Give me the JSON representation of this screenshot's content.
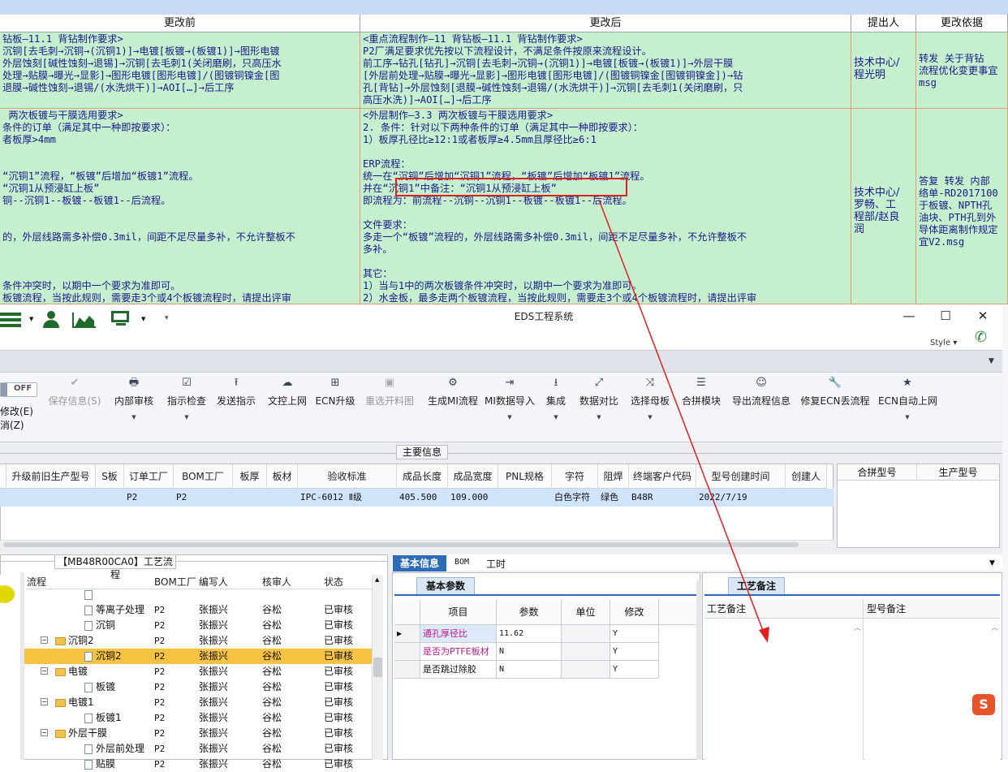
{
  "sheet": {
    "headers": [
      "更改前",
      "更改后",
      "提出人",
      "更改依据"
    ],
    "rows": [
      {
        "before": "钻板—11.1 背钻制作要求>\n沉铜[去毛刺→沉铜→(沉铜1)]→电镀[板镀→(板镀1)]→图形电镀\n外层蚀刻[碱性蚀刻→退锡]→沉铜[去毛刺1(关闭磨刷，只高压水\n处理→贴膜→曝光→显影]→图形电镀[图形电镀]/(图镀铜镍金[图\n退膜→碱性蚀刻→退锡/(水洗烘干)]→AOI[…]→后工序",
        "after": "<重点流程制作—11 背钻板—11.1 背钻制作要求>\nP2厂满足要求优先按以下流程设计，不满足条件按原来流程设计。\n前工序→钻孔[钻孔]→沉铜[去毛刺→沉铜→(沉铜1)]→电镀[板镀→(板镀1)]→外层干膜\n[外层前处理→贴膜→曝光→显影]→图形电镀[图形电镀]/(图镀铜镍金[图镀铜镍金])→钻\n孔[背钻]→外层蚀刻[退膜→碱性蚀刻→退锡/(水洗烘干)]→沉铜[去毛刺1(关闭磨刷，只\n高压水洗)]→AOI[…]→后工序",
        "proposer": "技术中心/\n程光明",
        "basis": "转发 关于背钻\n流程优化变更事宜\nmsg"
      },
      {
        "before": " 两次板镀与干膜选用要求>\n条件的订单（满足其中一种即按要求）：\n者板厚>4mm\n\n\n“沉铜1”流程，“板镀”后增加“板镀1”流程。\n“沉铜1从预浸缸上板”\n铜--沉铜1--板镀--板镀1--后流程。\n\n\n的，外层线路需多补偿0.3mil，间距不足尽量多补，不允许整板不\n\n\n\n条件冲突时，以期中一个要求为准即可。\n板镀流程，当按此规则，需要走3个或4个板镀流程时，请提出评审",
        "after": "<外层制作—3.3 两次板镀与干膜选用要求>\n2. 条件：针对以下两种条件的订单（满足其中一种即按要求）：\n1）板厚孔径比≥12:1或者板厚≥4.5mm且厚径比≥6:1\n\nERP流程：\n统一在“沉铜”后增加“沉铜1”流程，“板镀”后增加“板镀1”流程。\n并在“沉铜1”中备注：“沉铜1从预浸缸上板”\n即流程为：前流程--沉铜--沉铜1--板镀--板镀1--后流程。\n\n文件要求：\n多走一个“板镀”流程的，外层线路需多补偿0.3mil，间距不足尽量多补，不允许整板不\n多补。\n\n其它：\n1）当与1中的两次板镀条件冲突时，以期中一个要求为准即可。\n2）水金板，最多走两个板镀流程，当按此规则，需要走3个或4个板镀流程时，请提出评审",
        "proposer": "技术中心/\n罗畅、工\n程部/赵良\n润",
        "basis": "答复 转发 内部\n络单-RD2017100\n于板镀、NPTH孔\n油块、PTH孔到外\n导体距离制作规定\n宜V2.msg"
      }
    ]
  },
  "app": {
    "title": "EDS工程系统",
    "style_label": "Style",
    "toggle_off": "OFF",
    "left_labels": [
      "修改(E)",
      "消(Z)"
    ],
    "toolbar": [
      {
        "label": "保存信息(S)",
        "icon": "check-icon",
        "disabled": true,
        "dd": false
      },
      {
        "label": "内部审核",
        "icon": "print-icon",
        "disabled": false,
        "dd": true
      },
      {
        "label": "指示检查",
        "icon": "checkbox-icon",
        "disabled": false,
        "dd": true
      },
      {
        "label": "发送指示",
        "icon": "upload-icon",
        "disabled": false,
        "dd": false
      },
      {
        "label": "文控上网",
        "icon": "cloud-upload-icon",
        "disabled": false,
        "dd": false
      },
      {
        "label": "ECN升级",
        "icon": "binoculars-icon",
        "disabled": false,
        "dd": false
      },
      {
        "label": "重选开料图",
        "icon": "image-icon",
        "disabled": true,
        "dd": false
      },
      {
        "label": "生成MI流程",
        "icon": "gears-icon",
        "disabled": false,
        "dd": false
      },
      {
        "label": "MI数据导入",
        "icon": "import-icon",
        "disabled": false,
        "dd": true
      },
      {
        "label": "集成",
        "icon": "download-icon",
        "disabled": false,
        "dd": true
      },
      {
        "label": "数据对比",
        "icon": "compare-icon",
        "disabled": false,
        "dd": true
      },
      {
        "label": "选择母板",
        "icon": "shuffle-icon",
        "disabled": false,
        "dd": true
      },
      {
        "label": "合拼模块",
        "icon": "list-icon",
        "disabled": false,
        "dd": false
      },
      {
        "label": "导出流程信息",
        "icon": "smile-icon",
        "disabled": false,
        "dd": false
      },
      {
        "label": "修复ECN丢流程",
        "icon": "wrench-icon",
        "disabled": false,
        "dd": false
      },
      {
        "label": "ECN自动上网",
        "icon": "star-icon",
        "disabled": false,
        "dd": true
      }
    ],
    "main_info_label": "主要信息",
    "grid": {
      "columns": [
        "升级前旧生产型号",
        "S板",
        "订单工厂",
        "BOM工厂",
        "板厚",
        "板材",
        "验收标准",
        "成品长度",
        "成品宽度",
        "PNL规格",
        "字符",
        "阻焊",
        "终端客户代码",
        "型号创建时间",
        "创建人"
      ],
      "row": [
        "",
        "",
        "P2",
        "P2",
        "",
        "",
        "IPC-6012 Ⅱ级",
        "405.500",
        "109.000",
        "",
        "白色字符",
        "绿色",
        "B48R",
        "2022/7/19",
        ""
      ]
    },
    "merge_columns": [
      "合拼型号",
      "生产型号"
    ],
    "tree": {
      "title": "【MB48R00CA0】工艺流程",
      "columns": [
        "流程",
        "BOM工厂",
        "编写人",
        "核审人",
        "状态"
      ],
      "rows": [
        {
          "name": "",
          "type": "doc",
          "level": 2,
          "bom": "",
          "writer": "",
          "reviewer": "",
          "status": ""
        },
        {
          "name": "等离子处理",
          "type": "doc",
          "level": 2,
          "bom": "P2",
          "writer": "张振兴",
          "reviewer": "谷松",
          "status": "已审核"
        },
        {
          "name": "沉铜",
          "type": "doc",
          "level": 2,
          "bom": "P2",
          "writer": "张振兴",
          "reviewer": "谷松",
          "status": "已审核"
        },
        {
          "name": "沉铜2",
          "type": "folder",
          "level": 1,
          "bom": "P2",
          "writer": "张振兴",
          "reviewer": "谷松",
          "status": "已审核"
        },
        {
          "name": "沉铜2",
          "type": "doc",
          "level": 2,
          "bom": "P2",
          "writer": "张振兴",
          "reviewer": "谷松",
          "status": "已审核",
          "selected": true
        },
        {
          "name": "电镀",
          "type": "folder",
          "level": 1,
          "bom": "P2",
          "writer": "张振兴",
          "reviewer": "谷松",
          "status": "已审核"
        },
        {
          "name": "板镀",
          "type": "doc",
          "level": 2,
          "bom": "P2",
          "writer": "张振兴",
          "reviewer": "谷松",
          "status": "已审核"
        },
        {
          "name": "电镀1",
          "type": "folder",
          "level": 1,
          "bom": "P2",
          "writer": "张振兴",
          "reviewer": "谷松",
          "status": "已审核"
        },
        {
          "name": "板镀1",
          "type": "doc",
          "level": 2,
          "bom": "P2",
          "writer": "张振兴",
          "reviewer": "谷松",
          "status": "已审核"
        },
        {
          "name": "外层干膜",
          "type": "folder",
          "level": 1,
          "bom": "P2",
          "writer": "张振兴",
          "reviewer": "谷松",
          "status": "已审核"
        },
        {
          "name": "外层前处理",
          "type": "doc",
          "level": 2,
          "bom": "P2",
          "writer": "张振兴",
          "reviewer": "谷松",
          "status": "已审核"
        },
        {
          "name": "贴膜",
          "type": "doc",
          "level": 2,
          "bom": "P2",
          "writer": "张振兴",
          "reviewer": "谷松",
          "status": "已审核"
        }
      ]
    },
    "detail_tabs": [
      "基本信息",
      "BOM",
      "工时"
    ],
    "basic_params_tab": "基本参数",
    "params": {
      "columns": [
        "项目",
        "参数",
        "单位",
        "修改"
      ],
      "rows": [
        {
          "item": "通孔厚径比",
          "value": "11.62",
          "unit": "",
          "modify": "Y",
          "highlight": true
        },
        {
          "item": "是否为PTFE板材",
          "value": "N",
          "unit": "",
          "modify": "Y",
          "highlight": true
        },
        {
          "item": "是否跳过除胶",
          "value": "N",
          "unit": "",
          "modify": "Y",
          "highlight": false
        }
      ]
    },
    "notes_tab": "工艺备注",
    "notes_columns": [
      "工艺备注",
      "型号备注"
    ],
    "colors": {
      "sheet_bg": "#c6efce",
      "sheet_text": "#1a1a8a",
      "accent_blue": "#2f6cb8",
      "annotation_red": "#e02020",
      "highlight_text": "#c0168c",
      "selected_row": "#f5c242"
    }
  }
}
